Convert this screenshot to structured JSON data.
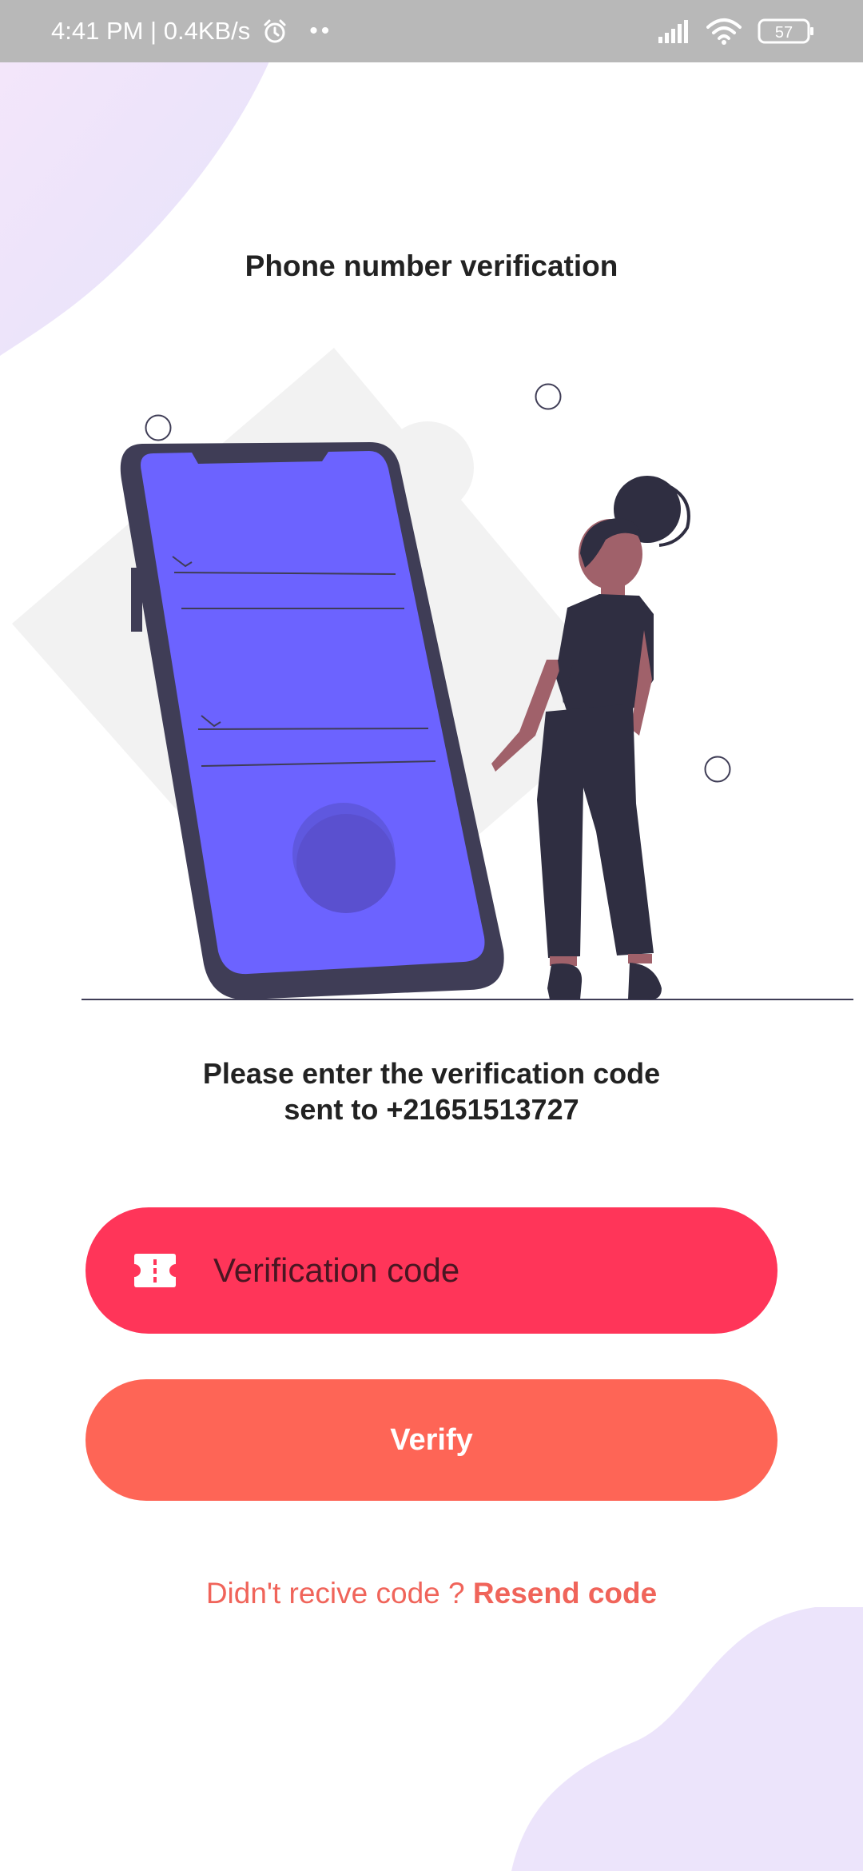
{
  "status_bar": {
    "time_speed": "4:41 PM | 0.4KB/s",
    "dots": "••",
    "battery": "57"
  },
  "screen": {
    "title": "Phone number verification",
    "prompt_line1": "Please enter the verification code",
    "prompt_line2": "sent to +21651513727"
  },
  "code_field": {
    "placeholder": "Verification code",
    "value": ""
  },
  "verify_button": {
    "label": "Verify"
  },
  "resend": {
    "question": "Didn't recive code ?",
    "link": "Resend code"
  },
  "colors": {
    "field_bg": "#ff3559",
    "button_bg": "#fe6556",
    "link": "#f0645a",
    "phone_screen": "#6c63ff",
    "dark": "#2f2e41"
  }
}
